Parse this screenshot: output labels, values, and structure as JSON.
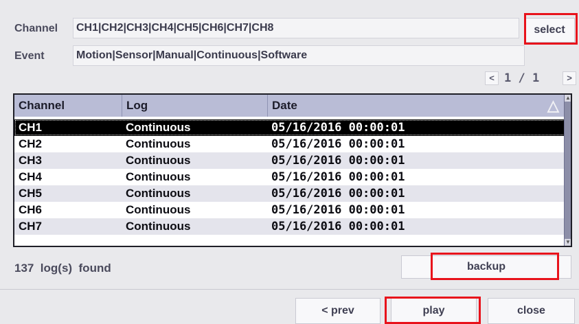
{
  "filter": {
    "channel_label": "Channel",
    "channel_value": "CH1|CH2|CH3|CH4|CH5|CH6|CH7|CH8",
    "select_label": "select",
    "event_label": "Event",
    "event_value": "Motion|Sensor|Manual|Continuous|Software"
  },
  "pager": {
    "prev_icon": "<",
    "next_icon": ">",
    "page_text": "1 / 1"
  },
  "table": {
    "columns": [
      "Channel",
      "Log",
      "Date"
    ],
    "sort_icon": "△",
    "rows": [
      {
        "channel": "CH1",
        "log": "Continuous",
        "date": "05/16/2016 00:00:01"
      },
      {
        "channel": "CH2",
        "log": "Continuous",
        "date": "05/16/2016 00:00:01"
      },
      {
        "channel": "CH3",
        "log": "Continuous",
        "date": "05/16/2016 00:00:01"
      },
      {
        "channel": "CH4",
        "log": "Continuous",
        "date": "05/16/2016 00:00:01"
      },
      {
        "channel": "CH5",
        "log": "Continuous",
        "date": "05/16/2016 00:00:01"
      },
      {
        "channel": "CH6",
        "log": "Continuous",
        "date": "05/16/2016 00:00:01"
      },
      {
        "channel": "CH7",
        "log": "Continuous",
        "date": "05/16/2016 00:00:01"
      }
    ]
  },
  "status": {
    "found_text": "137  log(s)  found"
  },
  "actions": {
    "backup_label": "backup",
    "prev_label": "< prev",
    "play_label": "play",
    "close_label": "close"
  },
  "colors": {
    "highlight": "#e8121b",
    "header_bg": "#b9bcd6",
    "selected_row_bg": "#000000"
  }
}
